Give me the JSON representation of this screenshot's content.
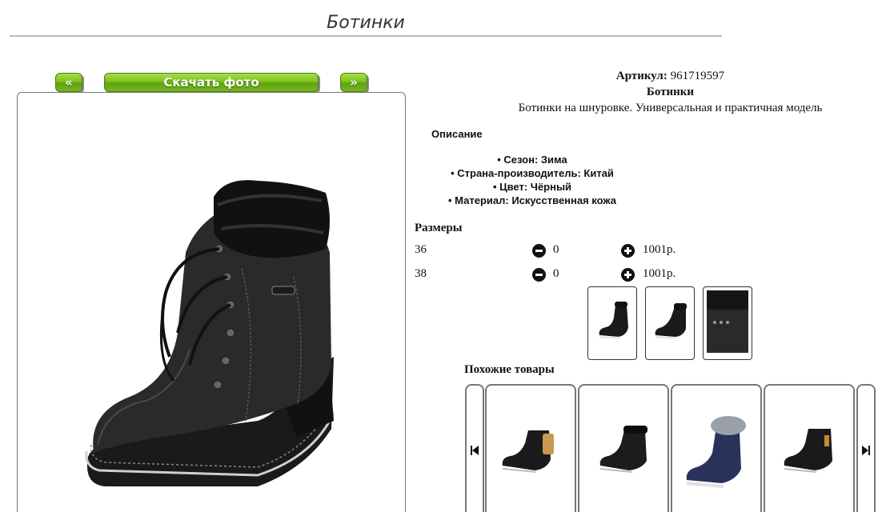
{
  "page": {
    "title": "Ботинки"
  },
  "gallery": {
    "prev_label": "«",
    "download_label": "Скачать фото",
    "next_label": "»",
    "main_image_icon": "black-leather-lace-up-boot-with-fur-cuff"
  },
  "product": {
    "article_label": "Артикул:",
    "article_value": "961719597",
    "name": "Ботинки",
    "short_description": "Ботинки на шнуровке. Универсальная и практичная модель"
  },
  "description": {
    "heading": "Описание",
    "properties": [
      "Сезон: Зима",
      "Страна-производитель: Китай",
      "Цвет: Чёрный",
      "Материал: Искусственная кожа"
    ]
  },
  "sizes": {
    "heading": "Размеры",
    "rows": [
      {
        "size": "36",
        "qty": "0",
        "price": "1001р."
      },
      {
        "size": "38",
        "qty": "0",
        "price": "1001р."
      }
    ]
  },
  "thumbnails": [
    "boot-front-view",
    "boot-side-view",
    "boot-detail-view"
  ],
  "similar": {
    "heading": "Похожие товары",
    "items": [
      "black-boot-tan-lining",
      "black-boot-fur-collar",
      "navy-boot-fur-hood",
      "black-boot-lace-up"
    ]
  },
  "colors": {
    "button_green": "#7cc21c",
    "border_gray": "#777777"
  }
}
